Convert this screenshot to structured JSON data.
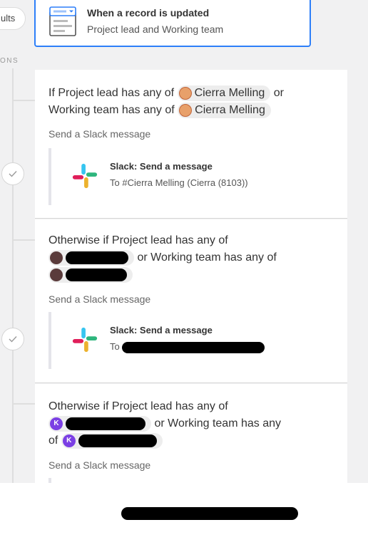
{
  "sidebar": {
    "results_pill": "ults",
    "section_label": "ONS"
  },
  "trigger": {
    "title": "When a record is updated",
    "subtitle": "Project lead and Working team"
  },
  "conditions": [
    {
      "text1": "If Project lead has any of",
      "chip1": "Cierra Melling",
      "text2": "or",
      "text3": "Working team has any of",
      "chip2": "Cierra Melling",
      "send_label": "Send a Slack message",
      "action_title": "Slack: Send a message",
      "action_sub": "To #Cierra Melling (Cierra (8103))"
    },
    {
      "text1": "Otherwise if Project lead has any of",
      "text2": "or Working team has any of",
      "send_label": "Send a Slack message",
      "action_title": "Slack: Send a message",
      "action_sub_prefix": "To"
    },
    {
      "text1": "Otherwise if Project lead has any of",
      "avatar_letter": "K",
      "text2": "or Working team has any",
      "text3": "of",
      "send_label": "Send a Slack message"
    }
  ],
  "colors": {
    "accent": "#2d7ff9",
    "slack_blue": "#36c5f0",
    "slack_green": "#2eb67d",
    "slack_yellow": "#ecb22e",
    "slack_red": "#e01e5a",
    "avatar_purple": "#7b3fe4"
  }
}
